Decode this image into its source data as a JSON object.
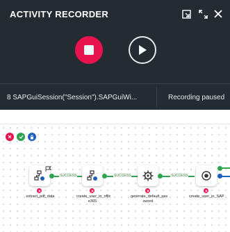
{
  "recorder": {
    "title": "ACTIVITY RECORDER",
    "controls": [
      "popout-icon",
      "expand-icon",
      "close-icon"
    ],
    "session_text": "8 SAPGuiSession(\"Session\").SAPGuiWi...",
    "status_text": "Recording paused",
    "colors": {
      "background": "#252b33",
      "stop": "#e8124f"
    }
  },
  "canvas": {
    "toolbar": [
      "close-circle-icon",
      "check-circle-icon",
      "lock-circle-icon"
    ],
    "nodes": [
      {
        "label": "extract_pdf_data",
        "icon": "workflow-icon"
      },
      {
        "label": "create_user_in_offic e365",
        "icon": "workflow-icon"
      },
      {
        "label": "generate_default_pas sword",
        "icon": "gear-icon"
      },
      {
        "label": "create_user_in_SAP",
        "icon": "record-icon"
      }
    ],
    "connections": [
      "SUCCESS",
      "SUCCESS",
      "SUCCESS"
    ],
    "colors": {
      "success": "#2ea44f",
      "error": "#e8124f"
    }
  }
}
